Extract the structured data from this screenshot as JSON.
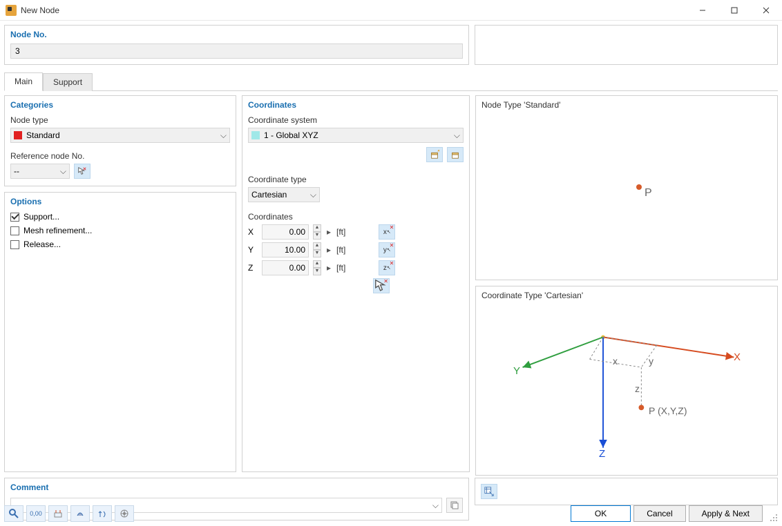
{
  "window": {
    "title": "New Node"
  },
  "nodeNo": {
    "label": "Node No.",
    "value": "3"
  },
  "tabs": {
    "main": "Main",
    "support": "Support"
  },
  "categories": {
    "title": "Categories",
    "nodeTypeLabel": "Node type",
    "nodeTypeValue": "Standard",
    "refNodeLabel": "Reference node No.",
    "refNodeValue": "--"
  },
  "options": {
    "title": "Options",
    "support": "Support...",
    "mesh": "Mesh refinement...",
    "release": "Release..."
  },
  "coords": {
    "title": "Coordinates",
    "systemLabel": "Coordinate system",
    "systemValue": "1 - Global XYZ",
    "typeLabel": "Coordinate type",
    "typeValue": "Cartesian",
    "coordsLabel": "Coordinates",
    "unit": "[ft]",
    "x": {
      "label": "X",
      "value": "0.00"
    },
    "y": {
      "label": "Y",
      "value": "10.00"
    },
    "z": {
      "label": "Z",
      "value": "0.00"
    }
  },
  "preview": {
    "nodeTypeTitle": "Node Type 'Standard'",
    "pLabel": "P",
    "coordTypeTitle": "Coordinate Type 'Cartesian'",
    "xLabel": "X",
    "yLabel": "Y",
    "zLabel": "Z",
    "pxyzLabel": "P (X,Y,Z)"
  },
  "comment": {
    "title": "Comment",
    "value": ""
  },
  "buttons": {
    "ok": "OK",
    "cancel": "Cancel",
    "applyNext": "Apply & Next"
  }
}
